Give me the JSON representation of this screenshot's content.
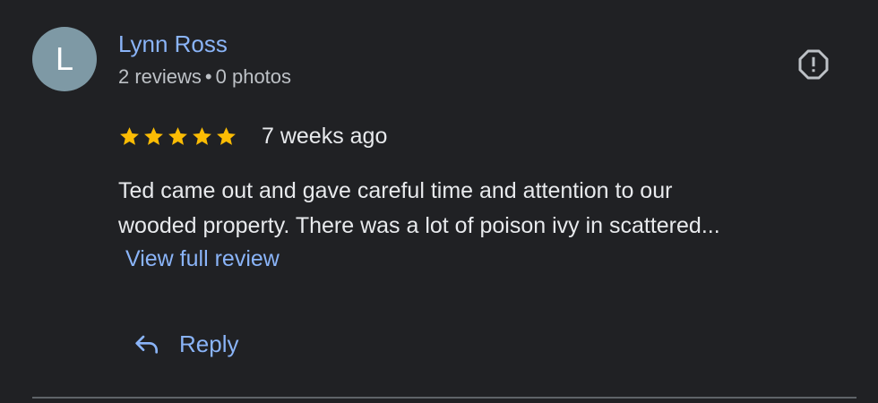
{
  "review": {
    "avatar_letter": "L",
    "reviewer_name": "Lynn Ross",
    "reviewer_reviews": "2 reviews",
    "reviewer_separator": "•",
    "reviewer_photos": "0 photos",
    "rating": 5,
    "rating_max": 5,
    "date": "7 weeks ago",
    "text_line_1": "Ted came out and gave careful time and attention to our",
    "text_line_2": "wooded property. There was a lot of poison ivy in scattered...",
    "view_full_label": "View full review",
    "reply_label": "Reply"
  },
  "icons": {
    "report": "report-octagon-icon",
    "star": "star-icon",
    "reply": "reply-arrow-icon"
  },
  "colors": {
    "background": "#202124",
    "link": "#8ab4f8",
    "star": "#fbbc04",
    "avatar": "#7e99a5",
    "text": "#e8eaed",
    "secondary_text": "#bdc1c6",
    "divider": "#5f6368"
  }
}
